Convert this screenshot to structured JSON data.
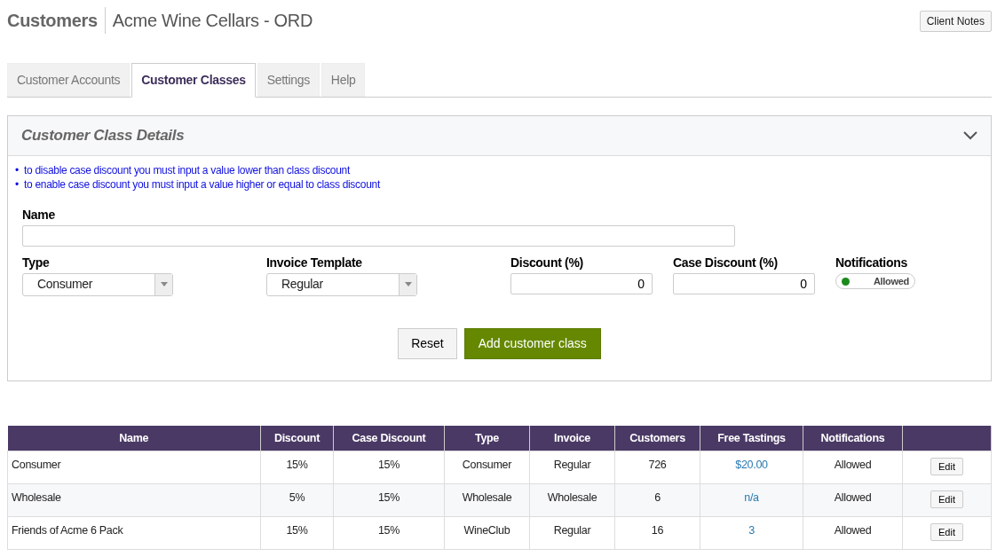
{
  "header": {
    "title": "Customers",
    "subtitle": "Acme Wine Cellars - ORD",
    "client_notes_button": "Client Notes"
  },
  "tabs": [
    {
      "label": "Customer Accounts",
      "selected": false
    },
    {
      "label": "Customer Classes",
      "selected": true
    },
    {
      "label": "Settings",
      "selected": false
    },
    {
      "label": "Help",
      "selected": false
    }
  ],
  "panel": {
    "title": "Customer Class Details",
    "expanded": true,
    "notes": [
      {
        "bullet": "•",
        "text": "to disable case discount you must input a value lower than class discount"
      },
      {
        "bullet": "•",
        "text": "to enable case discount you must input a value higher or equal to class discount"
      }
    ],
    "fields": [
      {
        "kind": "text",
        "label": "Name"
      },
      {
        "kind": "select",
        "label": "Type",
        "value": "Consumer"
      },
      {
        "kind": "select",
        "label": "Invoice Template",
        "value": "Regular"
      },
      {
        "kind": "number",
        "label": "Discount (%)",
        "value": "0"
      },
      {
        "kind": "number",
        "label": "Case Discount (%)",
        "value": "0"
      },
      {
        "kind": "toggle",
        "label": "Notifications",
        "value": "Allowed",
        "on": true
      }
    ],
    "buttons": [
      {
        "kind": "secondary",
        "label": "Reset"
      },
      {
        "kind": "primary",
        "label": "Add customer class"
      }
    ]
  },
  "table": {
    "columns": [
      "Name",
      "Discount",
      "Case Discount",
      "Type",
      "Invoice",
      "Customers",
      "Free Tastings",
      "Notifications"
    ],
    "rows": [
      {
        "cells": [
          "Consumer",
          "15%",
          "15%",
          "Consumer",
          "Regular",
          "726",
          "$20.00",
          "Allowed"
        ],
        "action": "Edit"
      },
      {
        "cells": [
          "Wholesale",
          "5%",
          "15%",
          "Wholesale",
          "Wholesale",
          "6",
          "n/a",
          "Allowed"
        ],
        "action": "Edit"
      },
      {
        "cells": [
          "Friends of Acme 6 Pack",
          "15%",
          "15%",
          "WineClub",
          "Regular",
          "16",
          "3",
          "Allowed"
        ],
        "action": "Edit"
      }
    ]
  }
}
